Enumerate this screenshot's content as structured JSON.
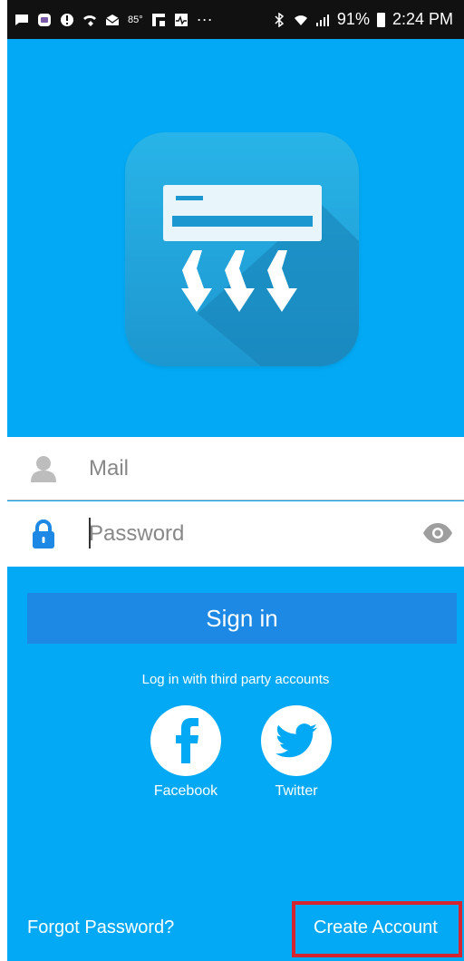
{
  "status_bar": {
    "temperature": "85°",
    "dots": "···",
    "battery_pct": "91%",
    "time": "2:24 PM",
    "icons": [
      "chat-icon",
      "vr-icon",
      "alert-icon",
      "wifi-call-icon",
      "mail-icon",
      "flipboard-icon",
      "activity-icon",
      "bluetooth-icon",
      "wifi-icon",
      "signal-icon",
      "battery-icon"
    ]
  },
  "login": {
    "mail_placeholder": "Mail",
    "password_placeholder": "Password",
    "sign_in_label": "Sign in",
    "third_party_label": "Log in with third party accounts",
    "facebook_label": "Facebook",
    "twitter_label": "Twitter",
    "forgot_label": "Forgot Password?",
    "create_label": "Create Account"
  },
  "colors": {
    "background": "#03a9f4",
    "sign_in_button": "#1e88e5",
    "highlight_box": "#d3242f",
    "lock_icon": "#1e88e5"
  }
}
